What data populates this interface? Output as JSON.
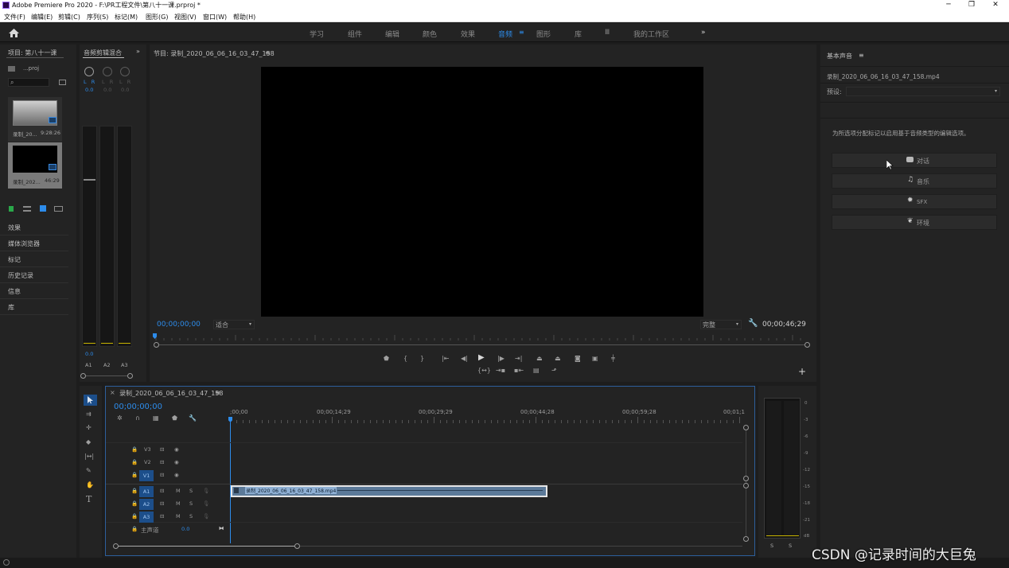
{
  "titlebar": {
    "title": "Adobe Premiere Pro 2020 - F:\\PR工程文件\\第八十一课.prproj *",
    "minimize": "─",
    "maximize": "❐",
    "close": "✕"
  },
  "menu": [
    "文件(F)",
    "编辑(E)",
    "剪辑(C)",
    "序列(S)",
    "标记(M)",
    "图形(G)",
    "视图(V)",
    "窗口(W)",
    "帮助(H)"
  ],
  "workspaces": [
    "学习",
    "组件",
    "编辑",
    "颜色",
    "效果",
    "音频",
    "图形",
    "库",
    "Ⅲ",
    "我的工作区"
  ],
  "active_workspace": "音频",
  "more_workspaces": "»",
  "project": {
    "title": "项目: 第八十一课",
    "file_label": "...proj",
    "search_placeholder": "",
    "clips": [
      {
        "name": "录制_20...",
        "duration": "9:28:26"
      },
      {
        "name": "录制_202...",
        "duration": "46:29"
      }
    ],
    "collapsed_panels": [
      "效果",
      "媒体浏览器",
      "标记",
      "历史记录",
      "信息",
      "库"
    ]
  },
  "audio_mixer": {
    "title": "音频剪辑混合",
    "expand": "»",
    "channels": [
      {
        "label": "A1",
        "value": "0.0",
        "lr": "L R"
      },
      {
        "label": "A2",
        "value": "0.0",
        "lr": "L R"
      },
      {
        "label": "A3",
        "value": "0.0",
        "lr": "L R"
      }
    ],
    "bottom_value": "0.0"
  },
  "program_monitor": {
    "title": "节目: 录制_2020_06_06_16_03_47_158",
    "menu_icon": "≡",
    "timecode_left": "00;00;00;00",
    "fit": "适合",
    "quality": "完整",
    "timecode_right": "00;00;46;29",
    "add": "+"
  },
  "essential_sound": {
    "title": "基本声音",
    "menu_icon": "≡",
    "filename": "录制_2020_06_06_16_03_47_158.mp4",
    "preset_label": "预设:",
    "preset_value": "",
    "description": "为所选项分配标记以启用基于音频类型的编辑选项。",
    "buttons": [
      {
        "label": "对话",
        "icon": "speech-icon"
      },
      {
        "label": "音乐",
        "icon": "music-note-icon"
      },
      {
        "label": "SFX",
        "icon": "starburst-icon"
      },
      {
        "label": "环境",
        "icon": "leaf-icon"
      }
    ]
  },
  "timeline": {
    "close": "×",
    "sequence_name": "录制_2020_06_06_16_03_47_158",
    "menu_icon": "≡",
    "timecode": "00;00;00;00",
    "ruler": [
      ";00;00",
      "00;00;14;29",
      "00;00;29;29",
      "00;00;44;28",
      "00;00;59;28",
      "00;01;1"
    ],
    "video_tracks": [
      "V3",
      "V2",
      "V1"
    ],
    "audio_tracks": [
      "A1",
      "A2",
      "A3"
    ],
    "mute_label": "M",
    "solo_label": "S",
    "master_label": "主声道",
    "master_value": "0.0",
    "clip_label": "录制_2020_06_06_16_03_47_158.mp4"
  },
  "master_meter": {
    "scale": [
      "0",
      "-3",
      "-6",
      "-9",
      "-12",
      "-15",
      "-18",
      "-21",
      "dB"
    ],
    "solo": [
      "S",
      "S"
    ]
  },
  "watermark": "CSDN @记录时间的大巨兔"
}
